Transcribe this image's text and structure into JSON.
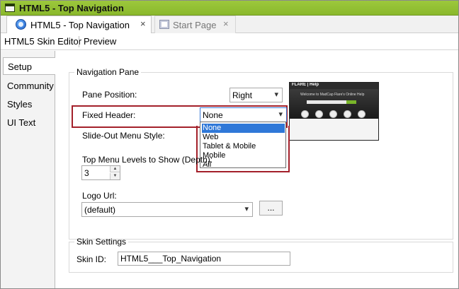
{
  "window": {
    "title": "HTML5 - Top Navigation"
  },
  "tabs": [
    {
      "label": "HTML5 - Top Navigation",
      "close": "×"
    },
    {
      "label": "Start Page",
      "close": "×"
    }
  ],
  "editor_toolbar": {
    "skin_editor": "HTML5 Skin Editor",
    "preview": "Preview"
  },
  "sidebar": {
    "items": [
      "Setup",
      "Community",
      "Styles",
      "UI Text"
    ]
  },
  "navigation_pane": {
    "legend": "Navigation Pane",
    "pane_position_label": "Pane Position:",
    "pane_position_value": "Right",
    "fixed_header_label": "Fixed Header:",
    "fixed_header_value": "None",
    "fixed_header_options": [
      "None",
      "Web",
      "Tablet & Mobile",
      "Mobile",
      "All"
    ],
    "slideout_label": "Slide-Out Menu Style:",
    "top_menu_levels_label": "Top Menu Levels to Show (Depth):",
    "top_menu_levels_value": "3",
    "logo_url_label": "Logo Url:",
    "logo_url_value": "(default)",
    "browse_label": "..."
  },
  "preview_thumb": {
    "logo": "FLARE | Help",
    "headline": "Welcome to MadCap Flare's Online Help"
  },
  "skin_settings": {
    "legend": "Skin Settings",
    "skin_id_label": "Skin ID:",
    "skin_id_value": "HTML5___Top_Navigation"
  },
  "colors": {
    "titlebar": "#8ab82c",
    "highlight_border": "#a3202a",
    "selection": "#2f78d8"
  },
  "icons": {
    "titlebar": "window-icon",
    "tab_active": "flare-project-icon",
    "tab_inactive": "start-page-icon",
    "combo": "chevron-down-icon"
  }
}
